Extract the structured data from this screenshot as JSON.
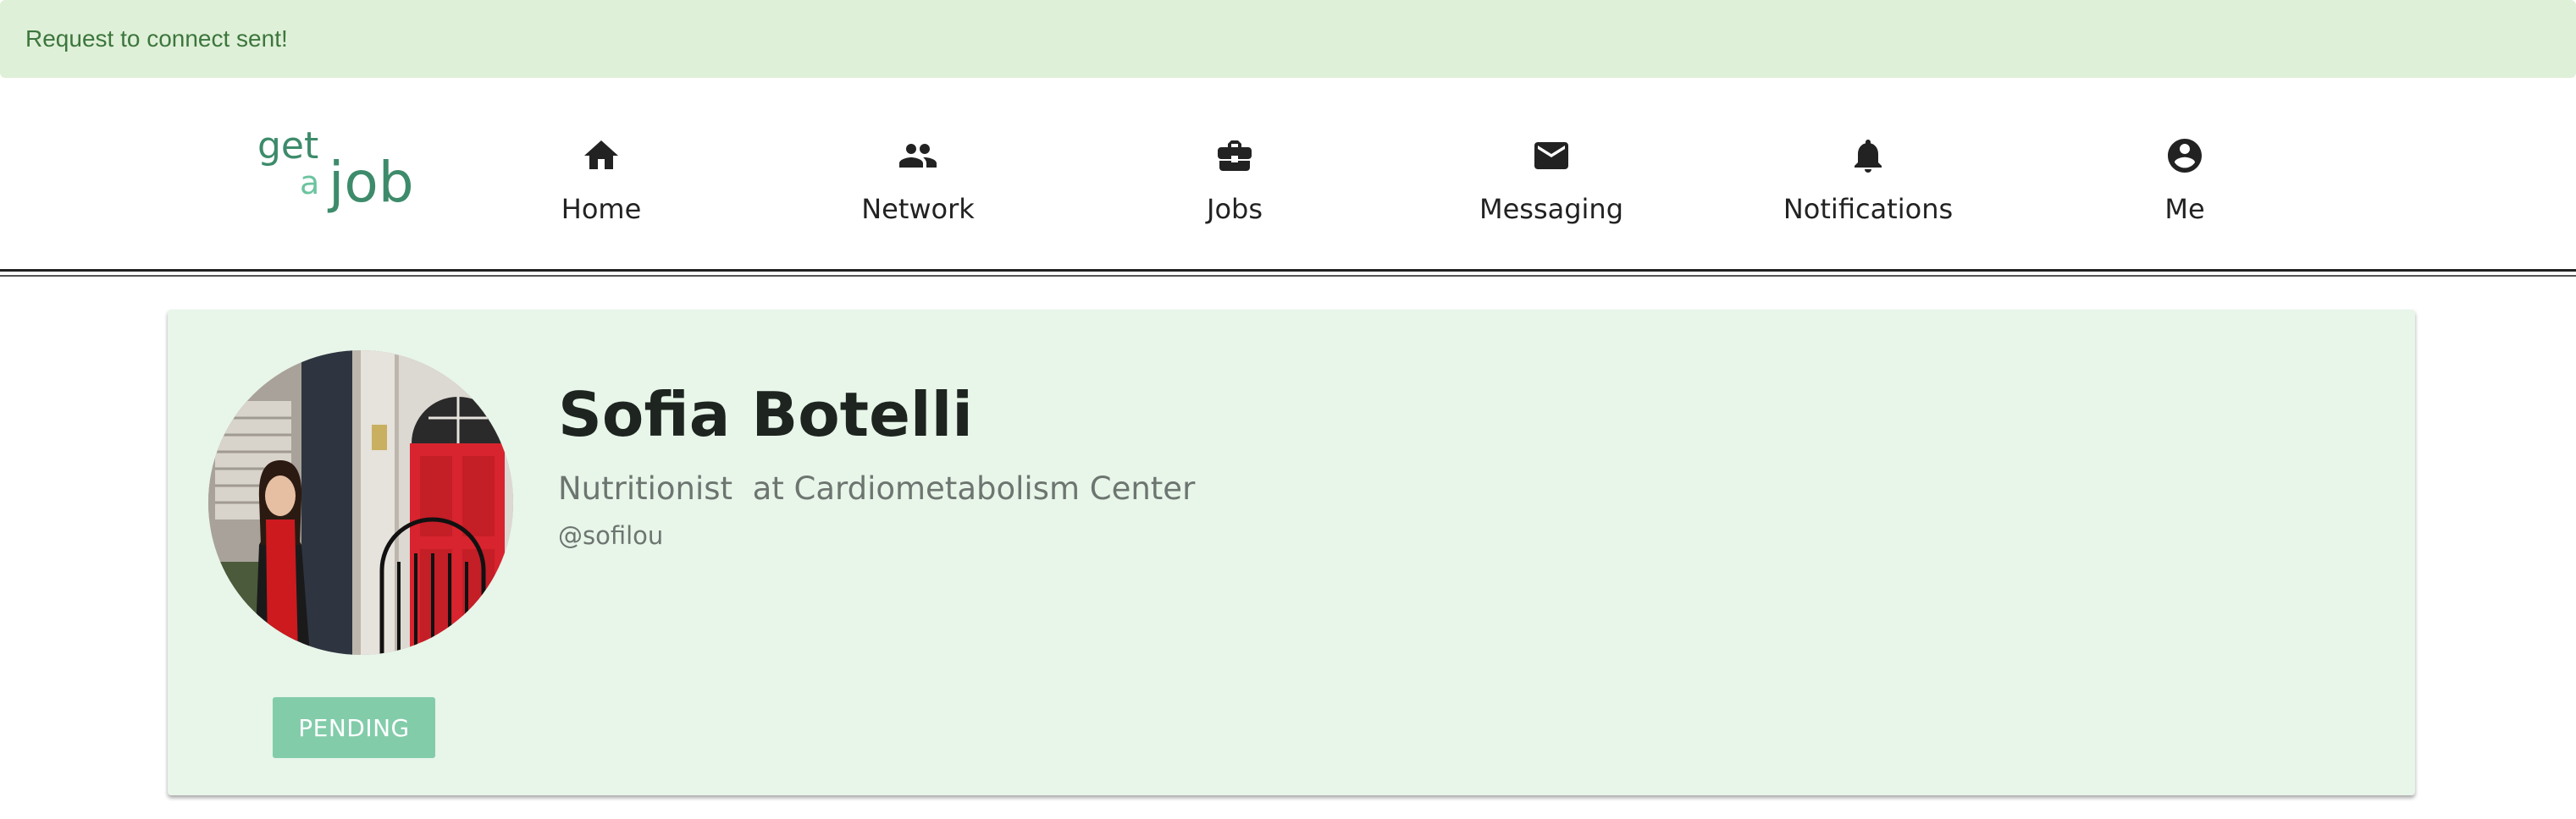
{
  "notification": {
    "message": "Request to connect sent!"
  },
  "brand": {
    "line1": "get",
    "line2a": "a",
    "line2b": "job",
    "color": "#3d8b6b"
  },
  "nav": {
    "items": [
      {
        "label": "Home",
        "icon": "home-icon"
      },
      {
        "label": "Network",
        "icon": "people-icon"
      },
      {
        "label": "Jobs",
        "icon": "briefcase-icon"
      },
      {
        "label": "Messaging",
        "icon": "envelope-icon"
      },
      {
        "label": "Notifications",
        "icon": "bell-icon"
      },
      {
        "label": "Me",
        "icon": "account-circle-icon"
      }
    ]
  },
  "profile": {
    "name": "Sofia Botelli",
    "title": "Nutritionist  at Cardiometabolism Center",
    "handle": "@sofilou",
    "avatar": "profile-photo",
    "connection_status": "PENDING"
  },
  "colors": {
    "toast_bg": "#dff0d8",
    "toast_text": "#3c763d",
    "card_bg": "#e8f5e9",
    "pending_button": "#82ccaa"
  }
}
